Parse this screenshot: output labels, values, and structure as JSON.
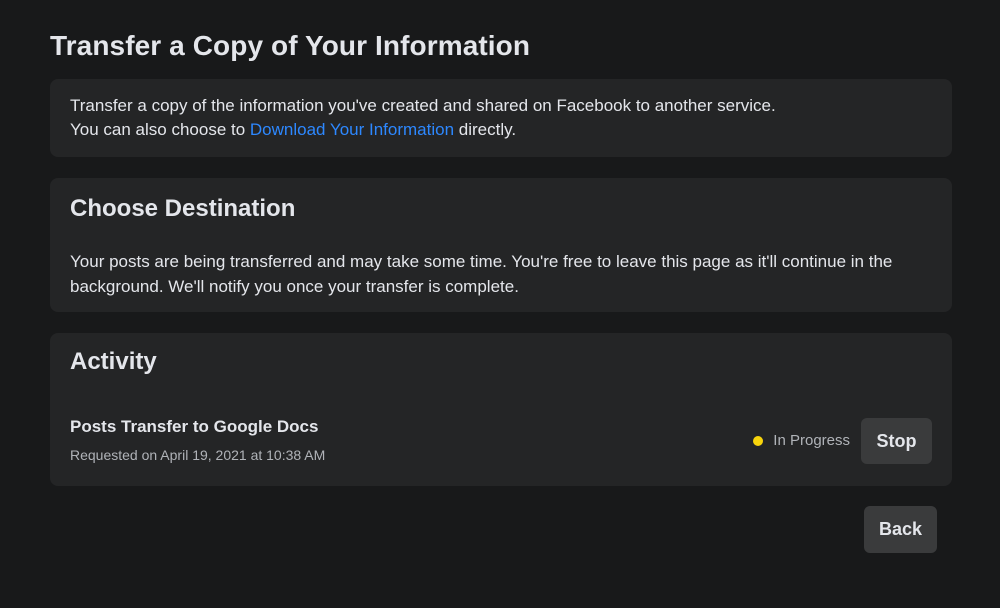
{
  "page": {
    "title": "Transfer a Copy of Your Information"
  },
  "intro": {
    "text_line1": "Transfer a copy of the information you've created and shared on Facebook to another service.",
    "text_line2_prefix": "You can also choose to ",
    "link_label": "Download Your Information",
    "text_line2_suffix": " directly."
  },
  "destination": {
    "title": "Choose Destination",
    "text": "Your posts are being transferred and may take some time. You're free to leave this page as it'll continue in the background. We'll notify you once your transfer is complete."
  },
  "activity": {
    "title": "Activity",
    "items": [
      {
        "name": "Posts Transfer to Google Docs",
        "requested": "Requested on April 19, 2021 at 10:38 AM",
        "status": "In Progress",
        "status_color": "#f7d40c",
        "action_label": "Stop"
      }
    ]
  },
  "footer": {
    "back_label": "Back"
  },
  "colors": {
    "background": "#18191a",
    "card": "#242526",
    "button": "#3a3b3c",
    "link": "#2d88ff"
  }
}
